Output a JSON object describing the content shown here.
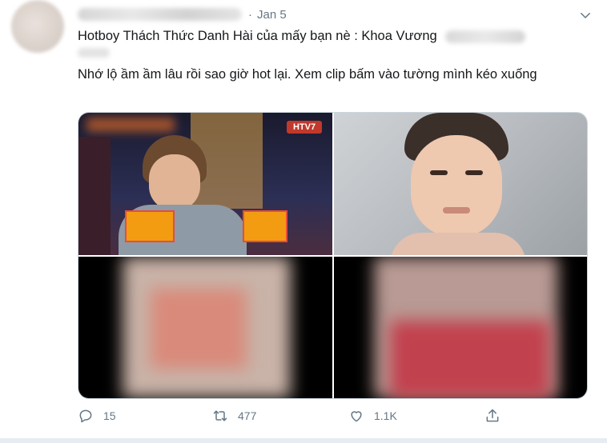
{
  "tweet": {
    "date": "Jan 5",
    "dot": "·",
    "line1": "Hotboy Thách Thức Danh Hài của mấy bạn nè : Khoa Vương",
    "line2": "Nhớ lộ ầm ầm lâu rồi sao giờ hot lại. Xem clip bấm vào tường mình kéo xuống"
  },
  "media": {
    "channel_logo": "HTV7"
  },
  "actions": {
    "reply_count": "15",
    "retweet_count": "477",
    "like_count": "1.1K"
  },
  "icons": {
    "more": "chevron-down-icon",
    "reply": "reply-icon",
    "retweet": "retweet-icon",
    "like": "heart-icon",
    "share": "share-icon"
  },
  "colors": {
    "text": "#14171a",
    "secondary": "#657786",
    "border": "#ccd6dd"
  }
}
